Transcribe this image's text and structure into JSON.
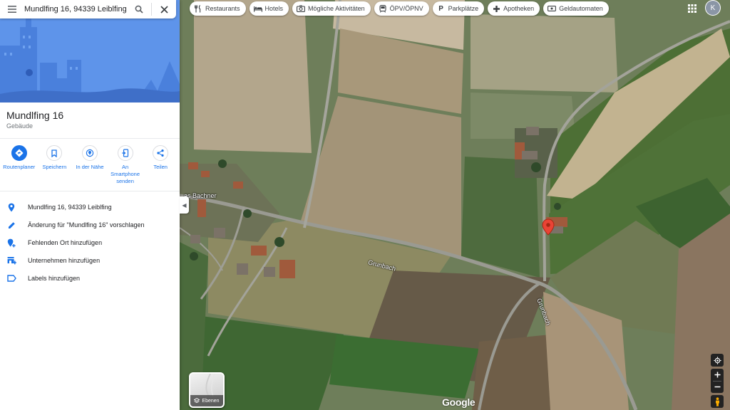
{
  "search": {
    "query": "Mundlfing 16, 94339 Leiblfing"
  },
  "place": {
    "name": "Mundlfing 16",
    "category": "Gebäude"
  },
  "actions": [
    {
      "label": "Routenplaner",
      "icon": "directions-icon"
    },
    {
      "label": "Speichern",
      "icon": "bookmark-icon"
    },
    {
      "label": "In der Nähe",
      "icon": "nearby-icon"
    },
    {
      "label": "An Smartphone senden",
      "icon": "phone-send-icon"
    },
    {
      "label": "Teilen",
      "icon": "share-icon"
    }
  ],
  "info": [
    {
      "text": "Mundlfing 16, 94339 Leiblfing",
      "icon": "location-pin-icon"
    },
    {
      "text": "Änderung für \"Mundlfing 16\" vorschlagen",
      "icon": "pencil-icon"
    },
    {
      "text": "Fehlenden Ort hinzufügen",
      "icon": "add-place-icon"
    },
    {
      "text": "Unternehmen hinzufügen",
      "icon": "add-business-icon"
    },
    {
      "text": "Labels hinzufügen",
      "icon": "label-icon"
    }
  ],
  "chips": [
    {
      "label": "Restaurants",
      "icon": "fork-knife-icon"
    },
    {
      "label": "Hotels",
      "icon": "bed-icon"
    },
    {
      "label": "Mögliche Aktivitäten",
      "icon": "camera-icon"
    },
    {
      "label": "ÖPV/ÖPNV",
      "icon": "transit-icon"
    },
    {
      "label": "Parkplätze",
      "icon": "parking-icon"
    },
    {
      "label": "Apotheken",
      "icon": "pharmacy-icon"
    },
    {
      "label": "Geldautomaten",
      "icon": "atm-icon"
    }
  ],
  "account": {
    "initial": "K"
  },
  "map": {
    "layers_label": "Ebenen",
    "road_labels": [
      "Grunbach",
      "Grunbach"
    ],
    "place_label": "as Bachner",
    "logo": "Google"
  },
  "colors": {
    "accent": "#1a73e8",
    "pin": "#ea4335",
    "hero": "#5e94ea"
  }
}
